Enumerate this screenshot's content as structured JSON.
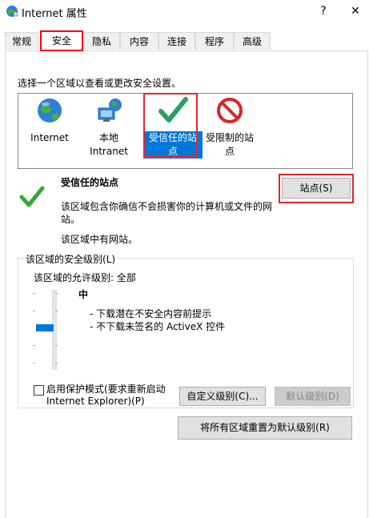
{
  "window": {
    "title": "Internet 属性",
    "help_glyph": "?",
    "close_glyph": "✕"
  },
  "tabs": [
    {
      "label": "常规"
    },
    {
      "label": "安全"
    },
    {
      "label": "隐私"
    },
    {
      "label": "内容"
    },
    {
      "label": "连接"
    },
    {
      "label": "程序"
    },
    {
      "label": "高级"
    }
  ],
  "zones": {
    "prompt": "选择一个区域以查看或更改安全设置。",
    "items": [
      {
        "line1": "Internet",
        "line2": "",
        "icon": "globe-icon"
      },
      {
        "line1": "本地",
        "line2": "Intranet",
        "icon": "intranet-icon"
      },
      {
        "line1": "受信任的站",
        "line2": "点",
        "icon": "checkmark-icon"
      },
      {
        "line1": "受限制的站",
        "line2": "点",
        "icon": "restricted-icon"
      }
    ]
  },
  "zone_info": {
    "title": "受信任的站点",
    "desc1": "该区域包含你确信不会损害你的计算机或文件的网",
    "desc2": "站。",
    "status": "该区域中有网站。",
    "sites_button": "站点(S)"
  },
  "security_level": {
    "group_label": "该区域的安全级别(L)",
    "allowed": "该区域的允许级别: 全部",
    "level": "中",
    "bullet1": "- 下载潜在不安全内容前提示",
    "bullet2": "- 不下载未签名的 ActiveX 控件",
    "protected_mode_line1": "启用保护模式(要求重新启动",
    "protected_mode_line2": "Internet Explorer)(P)",
    "protected_mode_checked": false,
    "custom_button": "自定义级别(C)...",
    "default_button": "默认级别(D)",
    "reset_all_button": "将所有区域重置为默认级别(R)"
  },
  "colors": {
    "accent": "#0078d7",
    "highlight": "#e0262b",
    "check_green": "#2e9e2e"
  }
}
